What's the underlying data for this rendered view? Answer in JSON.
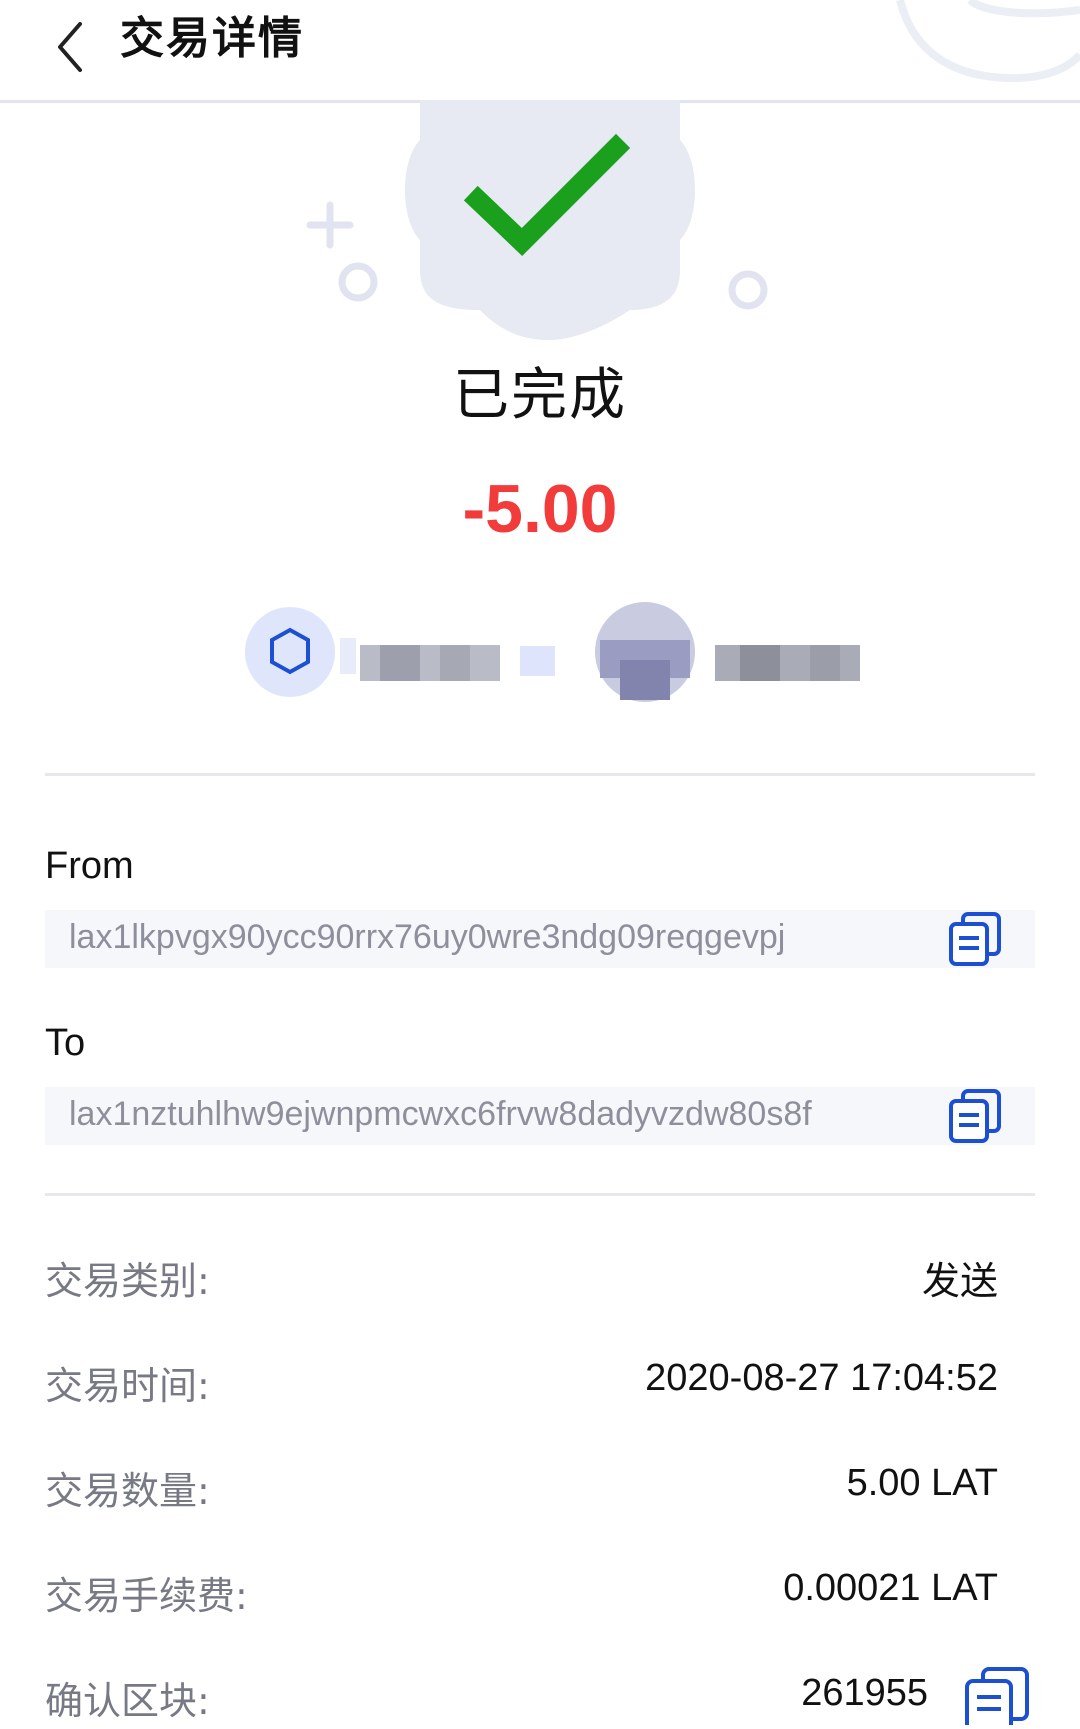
{
  "header": {
    "title": "交易详情"
  },
  "status": {
    "text": "已完成",
    "amount": "-5.00"
  },
  "from": {
    "label": "From",
    "address": "lax1lkpvgx90ycc90rrx76uy0wre3ndg09reqgevpj"
  },
  "to": {
    "label": "To",
    "address": "lax1nztuhlhw9ejwnpmcwxc6frvw8dadyvzdw80s8f"
  },
  "details": [
    {
      "label": "交易类别:",
      "value": "发送"
    },
    {
      "label": "交易时间:",
      "value": "2020-08-27 17:04:52"
    },
    {
      "label": "交易数量:",
      "value": "5.00 LAT"
    },
    {
      "label": "交易手续费:",
      "value": "0.00021 LAT"
    },
    {
      "label": "确认区块:",
      "value": "261955"
    }
  ],
  "colors": {
    "accent": "#1c4fd1",
    "check": "#1aa01c",
    "amount": "#f23b3b"
  }
}
